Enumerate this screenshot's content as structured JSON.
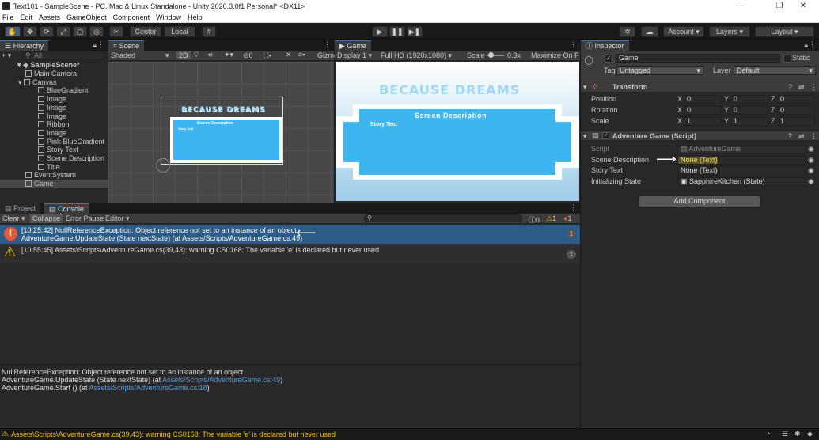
{
  "window": {
    "title": "Text101 - SampleScene - PC, Mac & Linux Standalone - Unity 2020.3.0f1 Personal* <DX11>",
    "minimize": "—",
    "maximize": "❐",
    "close": "✕"
  },
  "menu": [
    "File",
    "Edit",
    "Assets",
    "GameObject",
    "Component",
    "Window",
    "Help"
  ],
  "toolbar": {
    "pivot": "Center",
    "space": "Local",
    "account": "Account",
    "layers": "Layers",
    "layout": "Layout"
  },
  "hierarchy": {
    "tab": "Hierarchy",
    "search_placeholder": "All",
    "add": "+ ▾",
    "scene": "SampleScene*",
    "items": [
      {
        "label": "Main Camera",
        "indent": 1
      },
      {
        "label": "Canvas",
        "indent": 1
      },
      {
        "label": "BlueGradient",
        "indent": 2
      },
      {
        "label": "Image",
        "indent": 2
      },
      {
        "label": "Image",
        "indent": 2
      },
      {
        "label": "Image",
        "indent": 2
      },
      {
        "label": "Ribbon",
        "indent": 2
      },
      {
        "label": "Image",
        "indent": 2
      },
      {
        "label": "Pink-BlueGradient",
        "indent": 2
      },
      {
        "label": "Story Text",
        "indent": 2
      },
      {
        "label": "Scene Description",
        "indent": 2
      },
      {
        "label": "Title",
        "indent": 2
      },
      {
        "label": "EventSystem",
        "indent": 1
      },
      {
        "label": "Game",
        "indent": 1
      }
    ]
  },
  "scene": {
    "tab": "Scene",
    "shading": "Shaded",
    "mode2d": "2D",
    "hidden_count": "0",
    "gizmos": "Gizmo"
  },
  "game": {
    "tab": "Game",
    "display": "Display 1",
    "resolution": "Full HD (1920x1080)",
    "scale_label": "Scale",
    "scale_value": "0.3x",
    "maximize": "Maximize On Pl",
    "title": "BECAUSE DREAMS",
    "description": "Screen Description",
    "story": "Story Test"
  },
  "inspector": {
    "tab": "Inspector",
    "object_name": "Game",
    "static": "Static",
    "tag_label": "Tag",
    "tag": "Untagged",
    "layer_label": "Layer",
    "layer": "Default",
    "transform": {
      "title": "Transform",
      "position_label": "Position",
      "rotation_label": "Rotation",
      "scale_label": "Scale",
      "position": [
        "0",
        "0",
        "0"
      ],
      "rotation": [
        "0",
        "0",
        "0"
      ],
      "scale": [
        "1",
        "1",
        "1"
      ]
    },
    "script": {
      "title": "Adventure Game (Script)",
      "script_label": "Script",
      "script_value": "AdventureGame",
      "scene_desc_label": "Scene Description",
      "scene_desc_value": "None (Text)",
      "story_label": "Story Text",
      "story_value": "None (Text)",
      "init_label": "Initializing State",
      "init_value": "SapphireKitchen (State)"
    },
    "add_component": "Add Component"
  },
  "console": {
    "tab_project": "Project",
    "tab_console": "Console",
    "clear": "Clear",
    "collapse": "Collapse",
    "error_pause": "Error Pause",
    "editor": "Editor",
    "count_info": "0",
    "count_warn": "1",
    "count_error": "1",
    "entries": [
      {
        "type": "error",
        "line1": "[10:25:42] NullReferenceException: Object reference not set to an instance of an object",
        "line2": "AdventureGame.UpdateState (State nextState) (at Assets/Scripts/AdventureGame.cs:49)",
        "count": "1"
      },
      {
        "type": "warning",
        "line1": "[10:55:45] Assets\\Scripts\\AdventureGame.cs(39,43): warning CS0168: The variable 'e' is declared but never used",
        "line2": "",
        "count": "1"
      }
    ],
    "detail": {
      "line1": "NullReferenceException: Object reference not set to an instance of an object",
      "line2_prefix": "AdventureGame.UpdateState (State nextState) (at ",
      "line2_link": "Assets/Scripts/AdventureGame.cs:49",
      "line2_suffix": ")",
      "line3_prefix": "AdventureGame.Start () (at ",
      "line3_link": "Assets/Scripts/AdventureGame.cs:18",
      "line3_suffix": ")"
    }
  },
  "statusbar": "Assets\\Scripts\\AdventureGame.cs(39,43): warning CS0168: The variable 'e' is declared but never used",
  "colors": {
    "accent": "#3a79bb",
    "error": "#e05a3c",
    "warning": "#f0c000",
    "selection": "#2c5d87",
    "link": "#5a9bd8"
  }
}
